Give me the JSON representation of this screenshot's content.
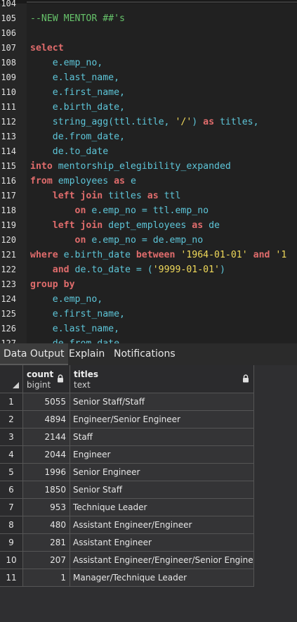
{
  "editor": {
    "lines": [
      {
        "no": "104",
        "tokens": []
      },
      {
        "no": "105",
        "tokens": [
          {
            "t": "--NEW MENTOR ##'s",
            "c": "cm"
          }
        ]
      },
      {
        "no": "106",
        "tokens": []
      },
      {
        "no": "107",
        "tokens": [
          {
            "t": "select",
            "c": "kw"
          }
        ]
      },
      {
        "no": "108",
        "tokens": [
          {
            "t": "    e.emp_no,",
            "c": "id"
          }
        ]
      },
      {
        "no": "109",
        "tokens": [
          {
            "t": "    e.last_name,",
            "c": "id"
          }
        ]
      },
      {
        "no": "110",
        "tokens": [
          {
            "t": "    e.first_name,",
            "c": "id"
          }
        ]
      },
      {
        "no": "111",
        "tokens": [
          {
            "t": "    e.birth_date,",
            "c": "id"
          }
        ]
      },
      {
        "no": "112",
        "tokens": [
          {
            "t": "    string_agg(ttl.title, ",
            "c": "id"
          },
          {
            "t": "'/'",
            "c": "st"
          },
          {
            "t": ") ",
            "c": "id"
          },
          {
            "t": "as",
            "c": "kw"
          },
          {
            "t": " titles,",
            "c": "id"
          }
        ]
      },
      {
        "no": "113",
        "tokens": [
          {
            "t": "    de.from_date,",
            "c": "id"
          }
        ]
      },
      {
        "no": "114",
        "tokens": [
          {
            "t": "    de.to_date",
            "c": "id"
          }
        ]
      },
      {
        "no": "115",
        "tokens": [
          {
            "t": "into",
            "c": "kw"
          },
          {
            "t": " mentorship_elegibility_expanded",
            "c": "id"
          }
        ]
      },
      {
        "no": "116",
        "tokens": [
          {
            "t": "from",
            "c": "kw"
          },
          {
            "t": " employees ",
            "c": "id"
          },
          {
            "t": "as",
            "c": "kw"
          },
          {
            "t": " e",
            "c": "id"
          }
        ]
      },
      {
        "no": "117",
        "tokens": [
          {
            "t": "    ",
            "c": "pl"
          },
          {
            "t": "left join",
            "c": "kw"
          },
          {
            "t": " titles ",
            "c": "id"
          },
          {
            "t": "as",
            "c": "kw"
          },
          {
            "t": " ttl",
            "c": "id"
          }
        ]
      },
      {
        "no": "118",
        "tokens": [
          {
            "t": "        ",
            "c": "pl"
          },
          {
            "t": "on",
            "c": "kw"
          },
          {
            "t": " e.emp_no = ttl.emp_no",
            "c": "id"
          }
        ]
      },
      {
        "no": "119",
        "tokens": [
          {
            "t": "    ",
            "c": "pl"
          },
          {
            "t": "left join",
            "c": "kw"
          },
          {
            "t": " dept_employees ",
            "c": "id"
          },
          {
            "t": "as",
            "c": "kw"
          },
          {
            "t": " de",
            "c": "id"
          }
        ]
      },
      {
        "no": "120",
        "tokens": [
          {
            "t": "        ",
            "c": "pl"
          },
          {
            "t": "on",
            "c": "kw"
          },
          {
            "t": " e.emp_no = de.emp_no",
            "c": "id"
          }
        ]
      },
      {
        "no": "121",
        "tokens": [
          {
            "t": "where",
            "c": "kw"
          },
          {
            "t": " e.birth_date ",
            "c": "id"
          },
          {
            "t": "between",
            "c": "kw"
          },
          {
            "t": " ",
            "c": "pl"
          },
          {
            "t": "'1964-01-01'",
            "c": "st"
          },
          {
            "t": " ",
            "c": "pl"
          },
          {
            "t": "and",
            "c": "kw"
          },
          {
            "t": " '1",
            "c": "st"
          }
        ]
      },
      {
        "no": "122",
        "tokens": [
          {
            "t": "    ",
            "c": "pl"
          },
          {
            "t": "and",
            "c": "kw"
          },
          {
            "t": " de.to_date = (",
            "c": "id"
          },
          {
            "t": "'9999-01-01'",
            "c": "st"
          },
          {
            "t": ")",
            "c": "id"
          }
        ]
      },
      {
        "no": "123",
        "tokens": [
          {
            "t": "group by",
            "c": "kw"
          }
        ]
      },
      {
        "no": "124",
        "tokens": [
          {
            "t": "    e.emp_no,",
            "c": "id"
          }
        ]
      },
      {
        "no": "125",
        "tokens": [
          {
            "t": "    e.first_name,",
            "c": "id"
          }
        ]
      },
      {
        "no": "126",
        "tokens": [
          {
            "t": "    e.last_name,",
            "c": "id"
          }
        ]
      },
      {
        "no": "127",
        "tokens": [
          {
            "t": "    de.from_date,",
            "c": "id"
          }
        ]
      }
    ]
  },
  "tabs": [
    {
      "label": "Data Output",
      "active": true
    },
    {
      "label": "Explain",
      "active": false
    },
    {
      "label": "Notifications",
      "active": false
    }
  ],
  "grid": {
    "columns": [
      {
        "name": "count",
        "type": "bigint"
      },
      {
        "name": "titles",
        "type": "text"
      }
    ],
    "rows": [
      {
        "idx": "1",
        "count": "5055",
        "titles": "Senior Staff/Staff"
      },
      {
        "idx": "2",
        "count": "4894",
        "titles": "Engineer/Senior Engineer"
      },
      {
        "idx": "3",
        "count": "2144",
        "titles": "Staff"
      },
      {
        "idx": "4",
        "count": "2044",
        "titles": "Engineer"
      },
      {
        "idx": "5",
        "count": "1996",
        "titles": "Senior Engineer"
      },
      {
        "idx": "6",
        "count": "1850",
        "titles": "Senior Staff"
      },
      {
        "idx": "7",
        "count": "953",
        "titles": "Technique Leader"
      },
      {
        "idx": "8",
        "count": "480",
        "titles": "Assistant Engineer/Engineer"
      },
      {
        "idx": "9",
        "count": "281",
        "titles": "Assistant Engineer"
      },
      {
        "idx": "10",
        "count": "207",
        "titles": "Assistant Engineer/Engineer/Senior Engineer"
      },
      {
        "idx": "11",
        "count": "1",
        "titles": "Manager/Technique Leader"
      }
    ]
  },
  "colors": {
    "keyword": "#e06c6c",
    "identifier": "#5dc5d8",
    "string": "#f0d95a",
    "comment": "#66c26a"
  }
}
